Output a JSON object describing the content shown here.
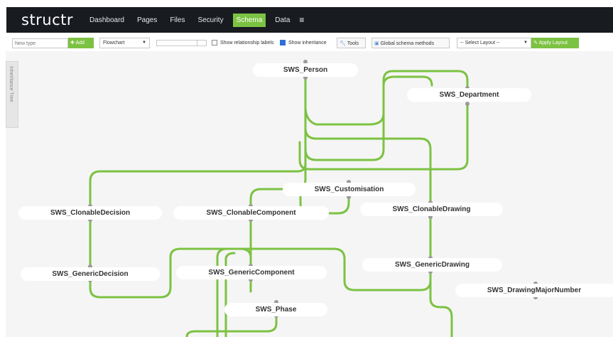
{
  "app": {
    "logo": "structr",
    "nav": [
      {
        "label": "Dashboard"
      },
      {
        "label": "Pages"
      },
      {
        "label": "Files"
      },
      {
        "label": "Security"
      },
      {
        "label": "Schema",
        "active": true
      },
      {
        "label": "Data"
      }
    ],
    "menu_icon": "≡"
  },
  "toolbar": {
    "new_type_placeholder": "New type",
    "add_label": "Add",
    "view_mode": "Flowchart",
    "show_relationship_labels": {
      "label": "Show relationship labels",
      "checked": false
    },
    "show_inheritance": {
      "label": "Show inheritance",
      "checked": true
    },
    "tools_label": "Tools",
    "global_methods_label": "Global schema methods",
    "layout_select": "-- Select Layout --",
    "apply_layout_label": "Apply Layout"
  },
  "sidebar": {
    "inheritance_tab": "Inheritance Tree"
  },
  "schema_nodes": [
    {
      "id": "person",
      "label": "SWS_Person"
    },
    {
      "id": "department",
      "label": "SWS_Department"
    },
    {
      "id": "customisation",
      "label": "SWS_Customisation"
    },
    {
      "id": "clonable_decision",
      "label": "SWS_ClonableDecision"
    },
    {
      "id": "clonable_component",
      "label": "SWS_ClonableComponent"
    },
    {
      "id": "clonable_drawing",
      "label": "SWS_ClonableDrawing"
    },
    {
      "id": "generic_decision",
      "label": "SWS_GenericDecision"
    },
    {
      "id": "generic_component",
      "label": "SWS_GenericComponent"
    },
    {
      "id": "generic_drawing",
      "label": "SWS_GenericDrawing"
    },
    {
      "id": "drawing_major_number",
      "label": "SWS_DrawingMajorNumber"
    },
    {
      "id": "phase",
      "label": "SWS_Phase"
    }
  ],
  "colors": {
    "edge": "#7cc242",
    "accent": "#7cc242",
    "navbar": "#181b20",
    "connector": "#9a9a9a"
  }
}
